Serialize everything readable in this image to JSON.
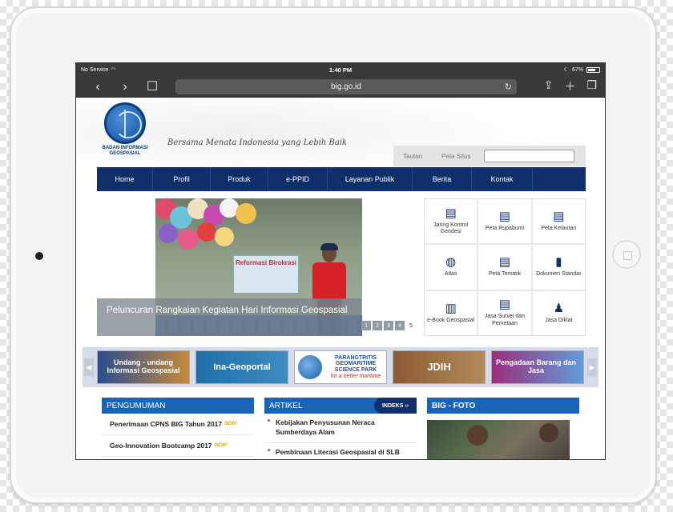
{
  "status_bar": {
    "carrier": "No Service",
    "time": "1:40 PM",
    "battery": "67%",
    "battery_level": 0.67
  },
  "browser": {
    "url": "big.go.id"
  },
  "header": {
    "logo_text": "BADAN INFORMASI GEOSPASIAL",
    "tagline": "Bersama Menata Indonesia yang Lebih Baik",
    "top_links": [
      "Tautan",
      "Peta Situs"
    ]
  },
  "nav": [
    "Home",
    "Profil",
    "Produk",
    "e-PPID",
    "Layanan Publik",
    "Berita",
    "Kontak"
  ],
  "hero": {
    "sign_text": "Reformasi Birokrasi",
    "caption": "Peluncuran Rangkaian Kegiatan Hari Informasi Geospasial",
    "pages": [
      "1",
      "2",
      "3",
      "4",
      "5"
    ],
    "active_page": "5"
  },
  "tiles": [
    {
      "label": "Jaring Kontrol Geodesi",
      "icon": "map-icon"
    },
    {
      "label": "Peta Rupabumi",
      "icon": "map-icon"
    },
    {
      "label": "Peta Kelautan",
      "icon": "map-icon"
    },
    {
      "label": "Atlas",
      "icon": "globe-icon"
    },
    {
      "label": "Peta Tematik",
      "icon": "map-icon"
    },
    {
      "label": "Dokumen Standar",
      "icon": "book-icon"
    },
    {
      "label": "e-Book Geospasial",
      "icon": "books-icon"
    },
    {
      "label": "Jasa Survei dan Pemetaan",
      "icon": "map-icon"
    },
    {
      "label": "Jasa Diklat",
      "icon": "person-icon"
    }
  ],
  "carousel": [
    "Undang - undang Informasi Geospasial",
    "Ina-Geoportal",
    "PARANGTRITIS GEOMARITIME SCIENCE PARK",
    "for a better maritime",
    "JDIH",
    "Pengadaan Barang dan Jasa"
  ],
  "pengumuman": {
    "title": "PENGUMUMAN",
    "new_label": "NEW!",
    "items": [
      "Penerimaan CPNS BIG Tahun 2017",
      "Geo-Innovation Bootcamp 2017"
    ]
  },
  "artikel": {
    "title": "ARTIKEL",
    "indeks": "INDEKS ››",
    "items": [
      "Kebijakan Penyusunan Neraca Sumberdaya Alam",
      "Pembinaan Literasi Geospasial di SLB"
    ]
  },
  "foto": {
    "title": "BIG - FOTO"
  },
  "colors": {
    "nav": "#0f2f6b",
    "section_header": "#1a63b6",
    "accent_red": "#c22"
  }
}
